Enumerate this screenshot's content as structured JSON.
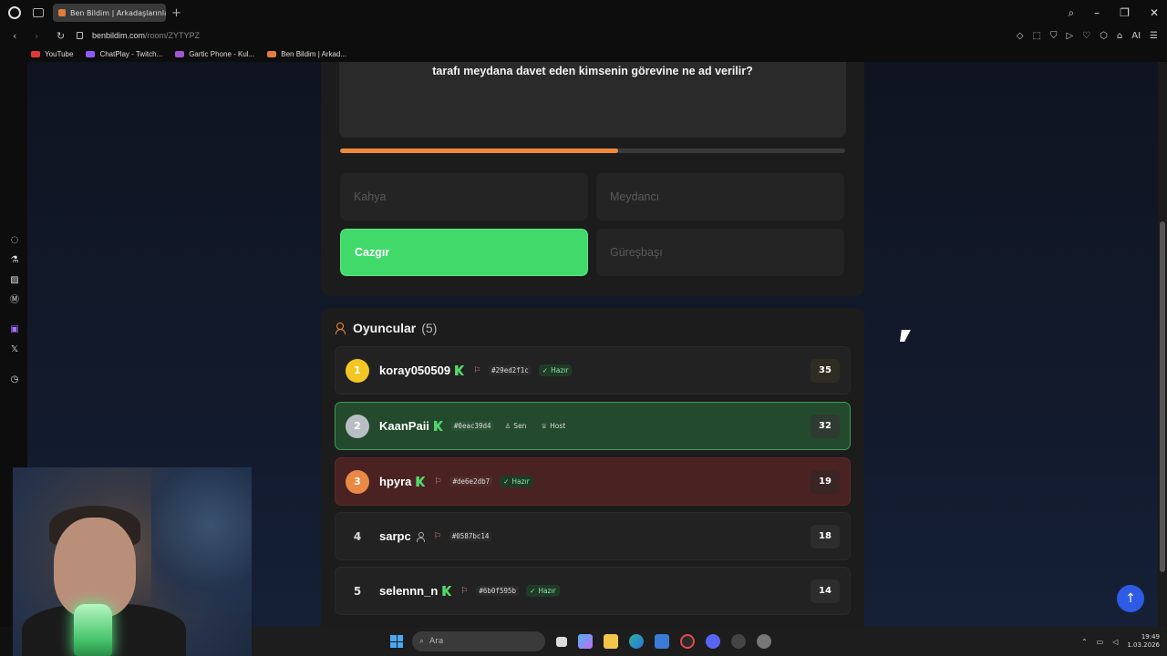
{
  "browser": {
    "tab_title": "Ben Bildim | Arkadaşlarınla",
    "new_tab": "+",
    "url_domain": "benbildim.com",
    "url_path": "/room/ZYTYPZ",
    "ai_label": "AI",
    "bookmarks": [
      {
        "label": "YouTube",
        "color": "#e53935"
      },
      {
        "label": "ChatPlay - Twitch...",
        "color": "#8f59ff"
      },
      {
        "label": "Gartic Phone - Kul...",
        "color": "#9b59d0"
      },
      {
        "label": "Ben Bildim | Arkad...",
        "color": "#e27d3b"
      }
    ]
  },
  "game": {
    "question": "tarafı meydana davet eden kimsenin görevine ne ad verilir?",
    "progress_percent": 55,
    "options": [
      {
        "label": "Kahya",
        "state": "dim"
      },
      {
        "label": "Meydancı",
        "state": "dim"
      },
      {
        "label": "Cazgır",
        "state": "correct"
      },
      {
        "label": "Güreşbaşı",
        "state": "dim"
      }
    ]
  },
  "players": {
    "title": "Oyuncular",
    "count": "(5)",
    "list": [
      {
        "rank": "1",
        "name": "koray050509",
        "id": "#29ed2f1c",
        "badge": "Hazır",
        "score": "35"
      },
      {
        "rank": "2",
        "name": "KaanPaii",
        "id": "#0eac39d4",
        "you": "Sen",
        "host": "Host",
        "score": "32"
      },
      {
        "rank": "3",
        "name": "hpyra",
        "id": "#de6e2db7",
        "badge": "Hazır",
        "score": "19"
      },
      {
        "rank": "4",
        "name": "sarpc",
        "id": "#0587bc14",
        "score": "18"
      },
      {
        "rank": "5",
        "name": "selennn_n",
        "id": "#6b0f595b",
        "badge": "Hazır",
        "score": "14"
      }
    ]
  },
  "taskbar": {
    "search_placeholder": "Ara",
    "time": "19:49",
    "date": "1.03.2026"
  },
  "icons": {
    "scroll_top": "↑",
    "ready_check": "✓",
    "crown": "♕",
    "person": "♙"
  }
}
